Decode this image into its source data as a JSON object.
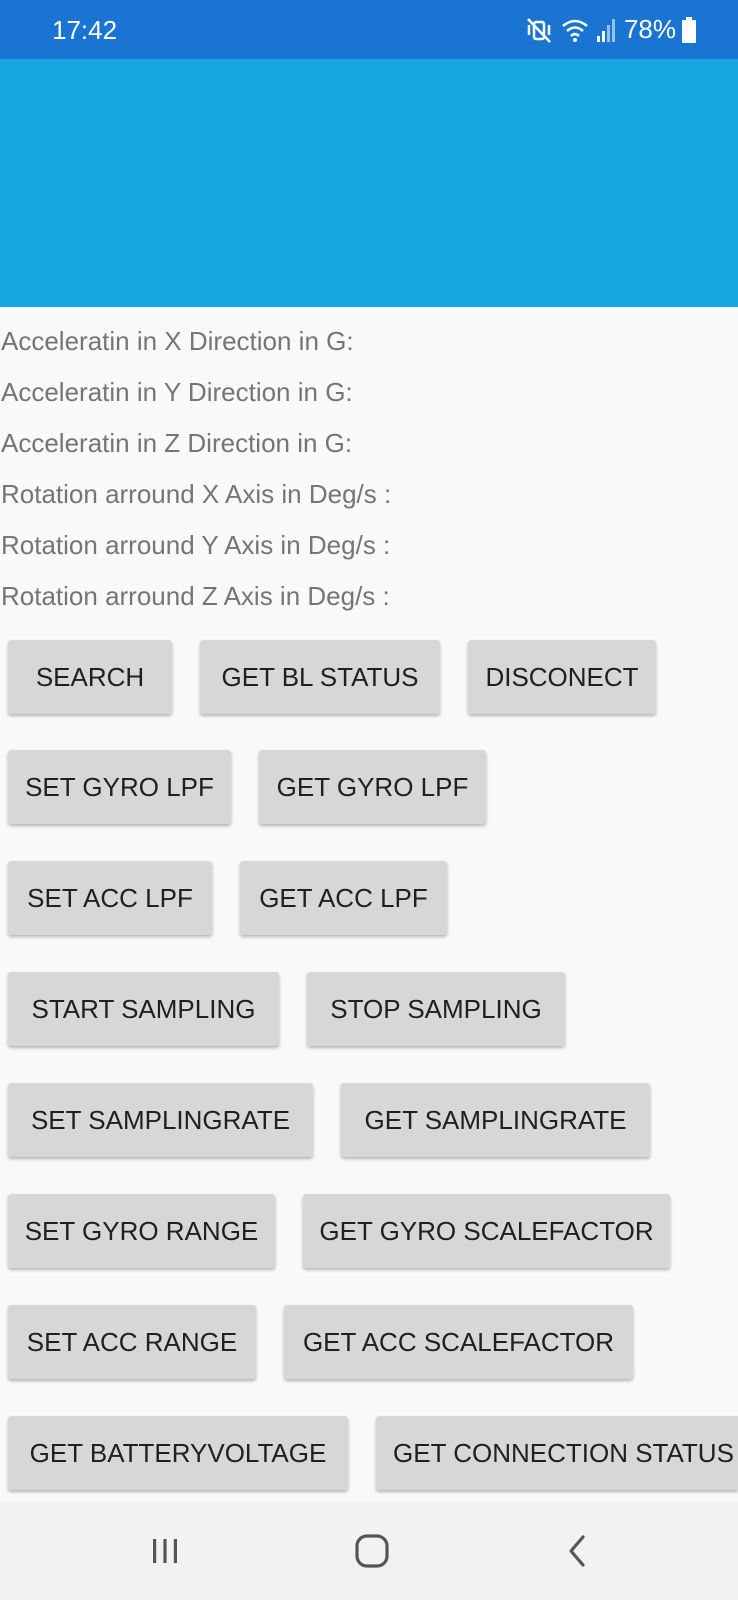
{
  "status_bar": {
    "time": "17:42",
    "battery_percent": "78%",
    "icons": [
      "mute-vibrate-icon",
      "wifi-icon",
      "signal-icon",
      "battery-icon"
    ]
  },
  "colors": {
    "status_bar": "#1a74d2",
    "app_bar": "#14a7e0",
    "button_bg": "#d6d7d7",
    "label_text": "#757575"
  },
  "readings": [
    "Acceleratin in X Direction in G:",
    "Acceleratin in Y Direction in G:",
    "Acceleratin in Z Direction in G:",
    "Rotation arround X Axis in Deg/s :",
    "Rotation arround Y Axis in Deg/s :",
    "Rotation arround Z Axis in Deg/s :"
  ],
  "buttons": {
    "search": "SEARCH",
    "get_bl_status": "GET BL STATUS",
    "disconnect": "DISCONECT",
    "set_gyro_lpf": "SET GYRO LPF",
    "get_gyro_lpf": "GET GYRO LPF",
    "set_acc_lpf": "SET ACC LPF",
    "get_acc_lpf": "GET ACC LPF",
    "start_sampling": "START SAMPLING",
    "stop_sampling": "STOP SAMPLING",
    "set_samplingrate": "SET SAMPLINGRATE",
    "get_samplingrate": "GET SAMPLINGRATE",
    "set_gyro_range": "SET GYRO RANGE",
    "get_gyro_scalefactor": "GET GYRO SCALEFACTOR",
    "set_acc_range": "SET ACC RANGE",
    "get_acc_scalefactor": "GET ACC SCALEFACTOR",
    "get_batteryvoltage": "GET BATTERYVOLTAGE",
    "get_connection_status": "GET CONNECTION STATUS"
  },
  "nav_bar": {
    "items": [
      "recent-apps-icon",
      "home-icon",
      "back-icon"
    ]
  }
}
